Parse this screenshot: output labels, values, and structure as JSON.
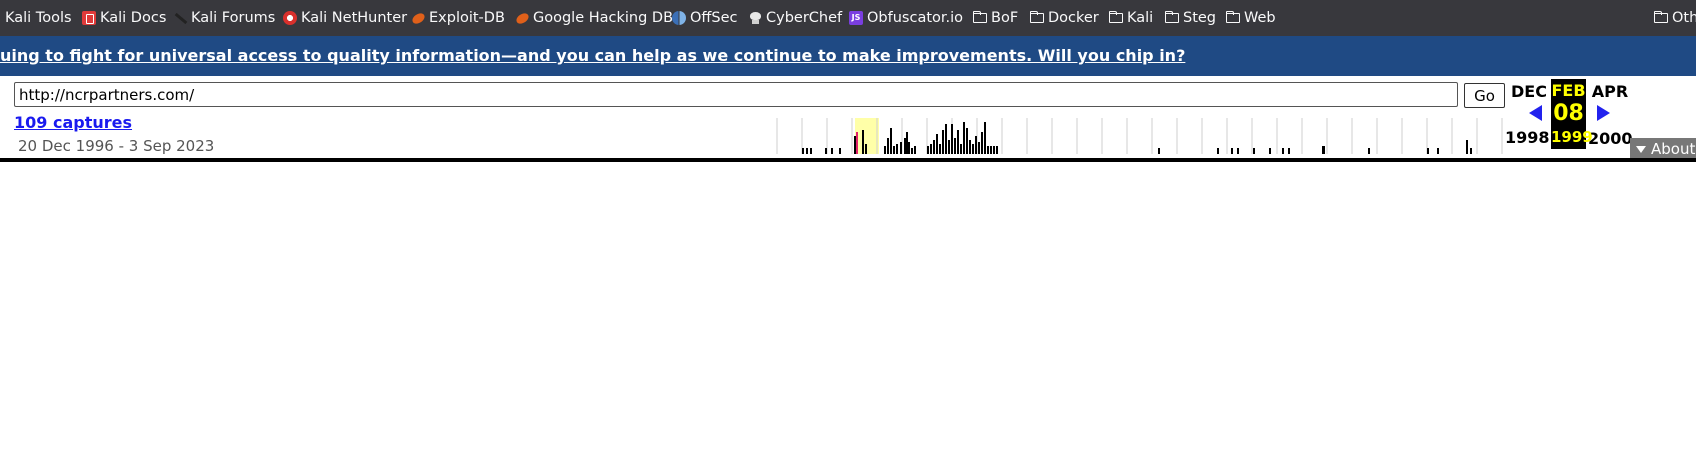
{
  "bookmarks": [
    {
      "label": "Kali Tools",
      "icon": "kali-icon"
    },
    {
      "label": "Kali Docs",
      "icon": "kali-docs-icon"
    },
    {
      "label": "Kali Forums",
      "icon": "kali-forums-icon"
    },
    {
      "label": "Kali NetHunter",
      "icon": "nethunter-icon"
    },
    {
      "label": "Exploit-DB",
      "icon": "exploit-db-icon"
    },
    {
      "label": "Google Hacking DB",
      "icon": "ghdb-icon"
    },
    {
      "label": "OffSec",
      "icon": "offsec-icon"
    },
    {
      "label": "CyberChef",
      "icon": "cyberchef-icon"
    },
    {
      "label": "Obfuscator.io",
      "icon": "obfuscator-icon"
    },
    {
      "label": "BoF",
      "icon": "folder-icon"
    },
    {
      "label": "Docker",
      "icon": "folder-icon"
    },
    {
      "label": "Kali",
      "icon": "folder-icon"
    },
    {
      "label": "Steg",
      "icon": "folder-icon"
    },
    {
      "label": "Web",
      "icon": "folder-icon"
    },
    {
      "label": "Oth",
      "icon": "folder-icon"
    }
  ],
  "banner": {
    "text": "uing to fight for universal access to quality information—and you can help as we continue to make improvements. Will you chip in?"
  },
  "wayback": {
    "url": "http://ncrpartners.com/",
    "go_label": "Go",
    "captures_label": "109 captures",
    "range_label": "20 Dec 1996 - 3 Sep 2023",
    "prev_month": "DEC",
    "current_month": "FEB",
    "next_month": "APR",
    "current_day": "08",
    "prev_year": "1998",
    "current_year": "1999",
    "next_year": "2000",
    "about_label": "About"
  },
  "colors": {
    "bookmarks_bg": "#38383d",
    "banner_bg": "#1f4a84",
    "calendar_highlight": "#ffff00",
    "link_blue": "#1a1aef",
    "arrow_blue": "#2222ee",
    "sparkline_highlight": "#ffffa8",
    "capture_marker": "#e0206a"
  }
}
